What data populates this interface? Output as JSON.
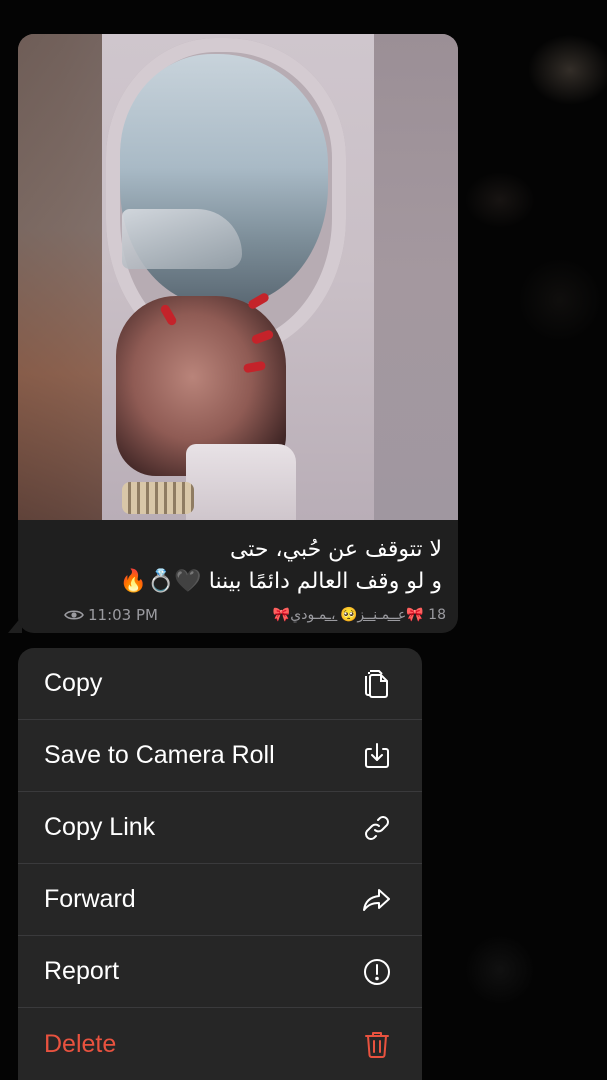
{
  "message": {
    "caption_line1": "لا تتوقف عن حُبي، حتى",
    "caption_line2": "و لو وقف العالم دائمًا بيننا 🖤💍🔥",
    "views": "18",
    "time": "11:03 PM",
    "author_signature": "🎀عـ͟͟ـمـنـ͟͟ـز🥺 ،͟͟ـمـودي🎀"
  },
  "menu": {
    "items": [
      {
        "label": "Copy",
        "icon": "copy-icon"
      },
      {
        "label": "Save to Camera Roll",
        "icon": "download-icon"
      },
      {
        "label": "Copy Link",
        "icon": "link-icon"
      },
      {
        "label": "Forward",
        "icon": "forward-arrow-icon"
      },
      {
        "label": "Report",
        "icon": "exclamation-circle-icon"
      },
      {
        "label": "Delete",
        "icon": "trash-icon"
      }
    ]
  },
  "colors": {
    "menu_background": "#262626",
    "destructive": "#e8523f",
    "bubble_background": "#1f1f1f"
  }
}
